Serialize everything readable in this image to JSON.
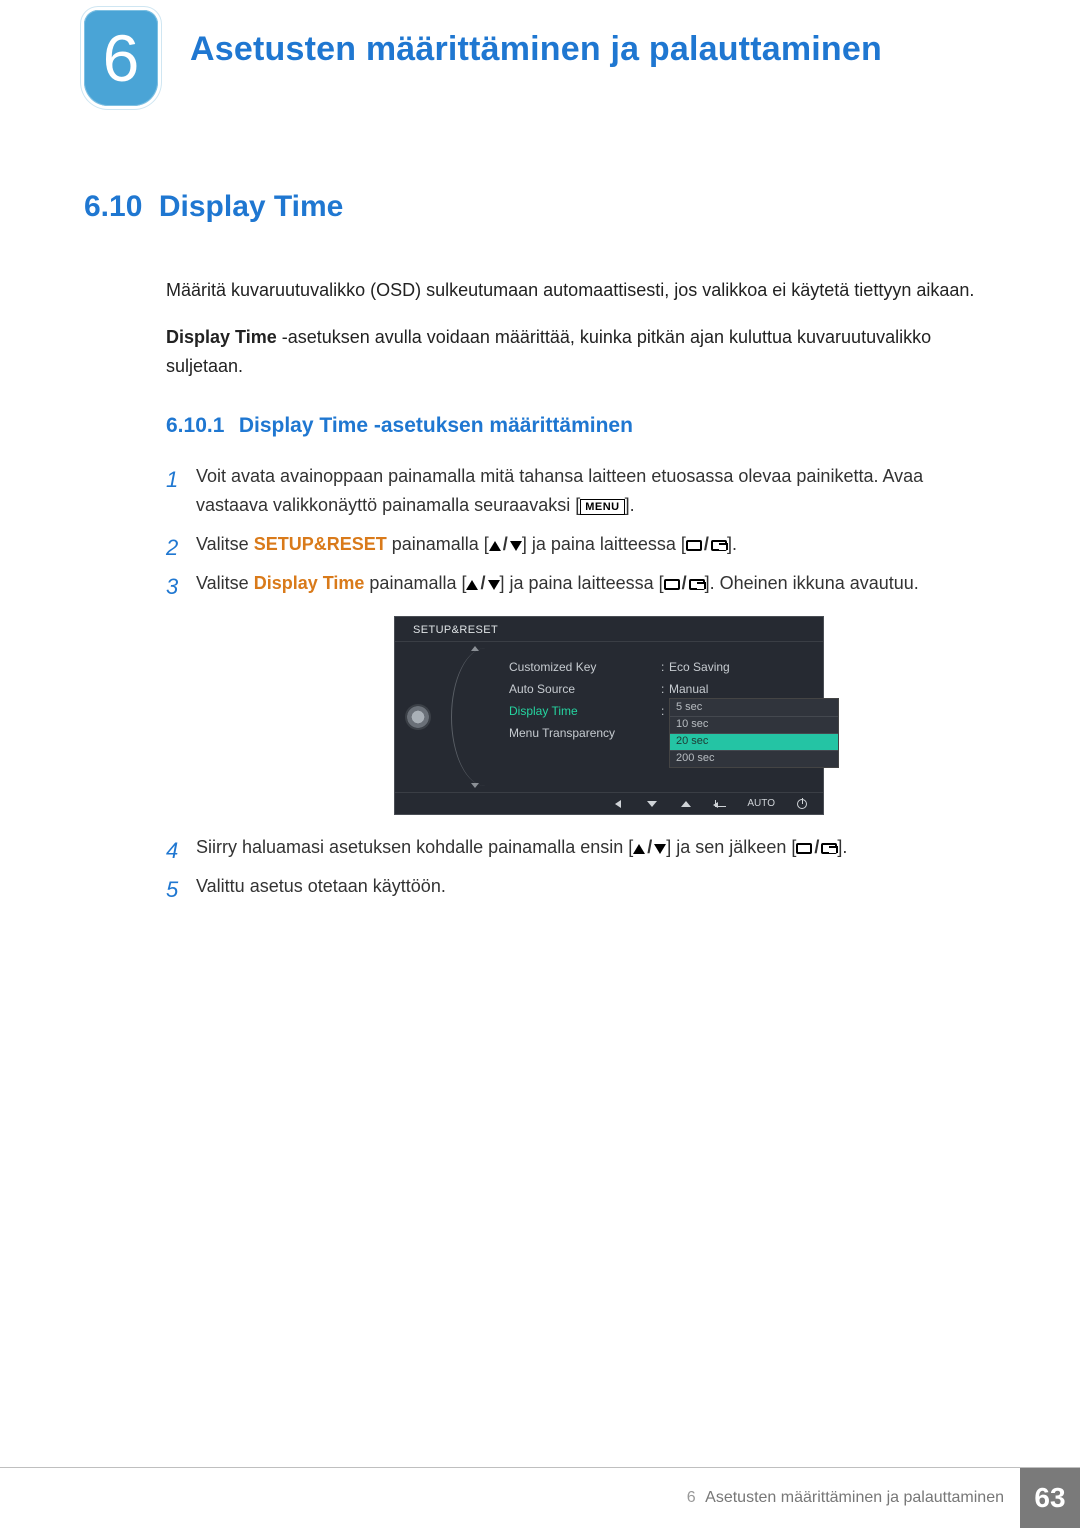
{
  "chapter": {
    "number": "6",
    "title": "Asetusten määrittäminen ja palauttaminen"
  },
  "section": {
    "number": "6.10",
    "title": "Display Time"
  },
  "intro": {
    "p1": "Määritä kuvaruutuvalikko (OSD) sulkeutumaan automaattisesti, jos valikkoa ei käytetä tiettyyn aikaan.",
    "p2_bold": "Display Time",
    "p2_rest": " -asetuksen avulla voidaan määrittää, kuinka pitkän ajan kuluttua kuvaruutuvalikko suljetaan."
  },
  "subsection": {
    "number": "6.10.1",
    "title": "Display Time -asetuksen määrittäminen"
  },
  "steps": {
    "s1a": "Voit avata avainoppaan painamalla mitä tahansa laitteen etuosassa olevaa painiketta. Avaa vastaava valikkonäyttö painamalla seuraavaksi [",
    "menu_label": "MENU",
    "s1b": "].",
    "s2a": "Valitse ",
    "s2_bold": "SETUP&RESET",
    "s2b": " painamalla [",
    "s2c": "] ja paina laitteessa [",
    "s2d": "].",
    "s3a": "Valitse ",
    "s3_bold": "Display Time",
    "s3b": " painamalla [",
    "s3c": "] ja paina laitteessa [",
    "s3d": "]. Oheinen ikkuna avautuu.",
    "s4a": "Siirry haluamasi asetuksen kohdalle painamalla ensin [",
    "s4b": "] ja sen jälkeen [",
    "s4c": "].",
    "s5": "Valittu asetus otetaan käyttöön."
  },
  "osd": {
    "title": "SETUP&RESET",
    "rows": [
      {
        "label": "Customized Key",
        "value": "Eco Saving"
      },
      {
        "label": "Auto Source",
        "value": "Manual"
      },
      {
        "label": "Display Time",
        "value": ""
      },
      {
        "label": "Menu Transparency",
        "value": ""
      }
    ],
    "options": [
      "5 sec",
      "10 sec",
      "20 sec",
      "200 sec"
    ],
    "selected_option_index": 2,
    "bottom_auto_label": "AUTO"
  },
  "footer": {
    "chapter_num": "6",
    "chapter_text": "Asetusten määrittäminen ja palauttaminen",
    "page": "63"
  }
}
